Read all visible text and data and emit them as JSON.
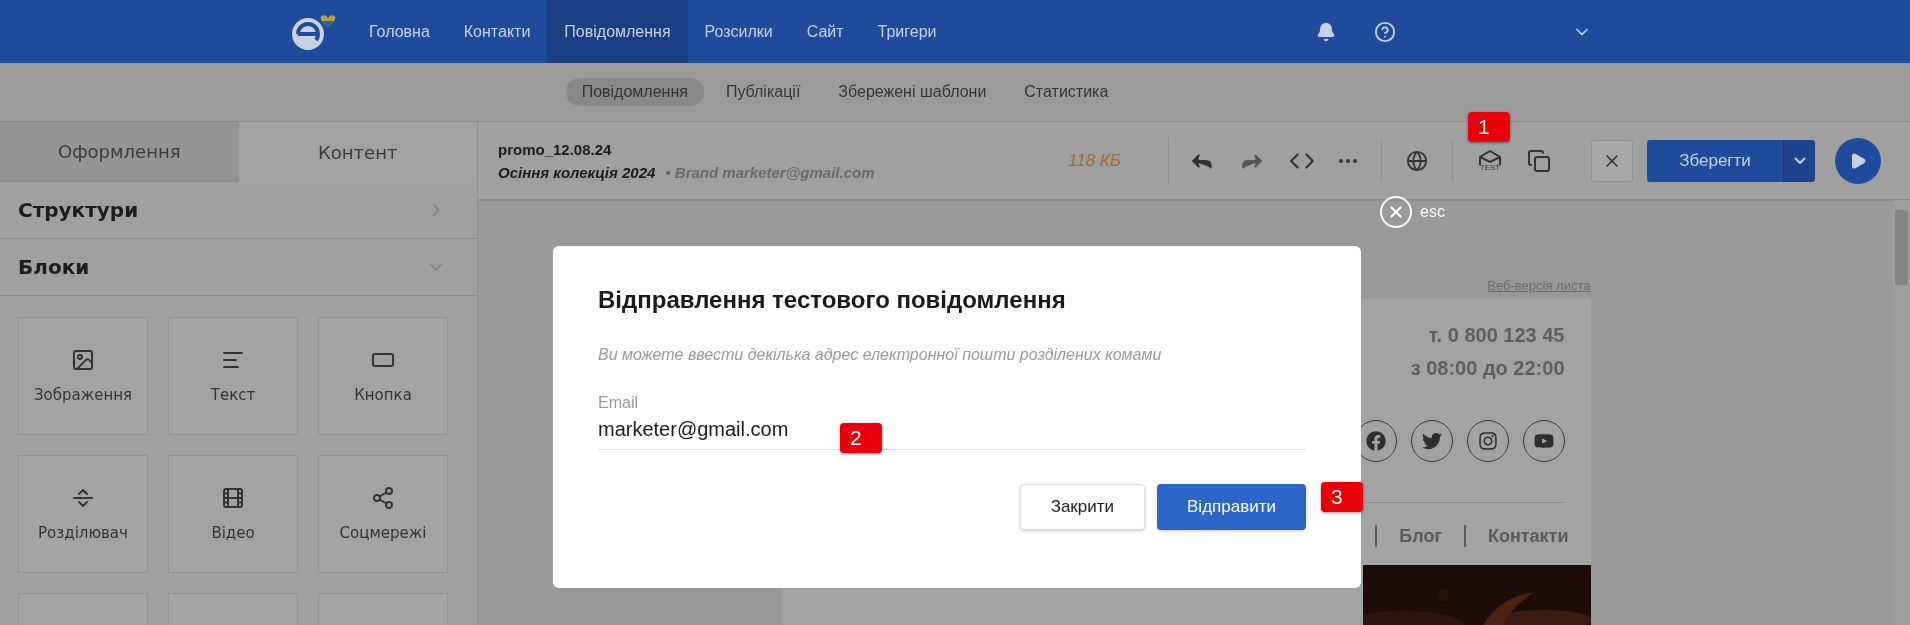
{
  "nav": {
    "items": [
      {
        "label": "Головна",
        "selected": false
      },
      {
        "label": "Контакти",
        "selected": false
      },
      {
        "label": "Повідомлення",
        "selected": true
      },
      {
        "label": "Розсилки",
        "selected": false
      },
      {
        "label": "Сайт",
        "selected": false
      },
      {
        "label": "Тригери",
        "selected": false
      }
    ]
  },
  "subnav": {
    "tabs": [
      {
        "label": "Повідомлення",
        "selected": true
      },
      {
        "label": "Публікації",
        "selected": false
      },
      {
        "label": "Збережені шаблони",
        "selected": false
      },
      {
        "label": "Статистика",
        "selected": false
      }
    ]
  },
  "sidebar": {
    "tabs": [
      {
        "label": "Оформлення",
        "selected": false
      },
      {
        "label": "Контент",
        "selected": true
      }
    ],
    "sections": [
      {
        "title": "Структури",
        "expanded": false
      },
      {
        "title": "Блоки",
        "expanded": true
      }
    ],
    "blocks": [
      "Зображення",
      "Текст",
      "Кнопка",
      "Розділювач",
      "Відео",
      "Соцмережі"
    ]
  },
  "toolbar": {
    "name": "promo_12.08.24",
    "subject": "Осіння колекція 2024",
    "sender": "• Brand marketer@gmail.com",
    "size": "118 КБ",
    "test_label": "TEST",
    "save": "Зберегти",
    "esc": "esc"
  },
  "annotations": [
    "1",
    "2",
    "3"
  ],
  "modal": {
    "title": "Відправлення тестового повідомлення",
    "hint": "Ви можете ввести декілька адрес електронної пошти розділених комами",
    "field": {
      "label": "Email",
      "value": "marketer@gmail.com"
    },
    "buttons": [
      {
        "label": "Закрити",
        "kind": "secondary"
      },
      {
        "label": "Відправити",
        "kind": "primary"
      }
    ]
  },
  "email": {
    "web_version": "Веб-версія листа",
    "phone": "т. 0 800 123 45",
    "hours": "з 08:00 до 22:00",
    "links": [
      "Блог",
      "Контакти"
    ]
  }
}
